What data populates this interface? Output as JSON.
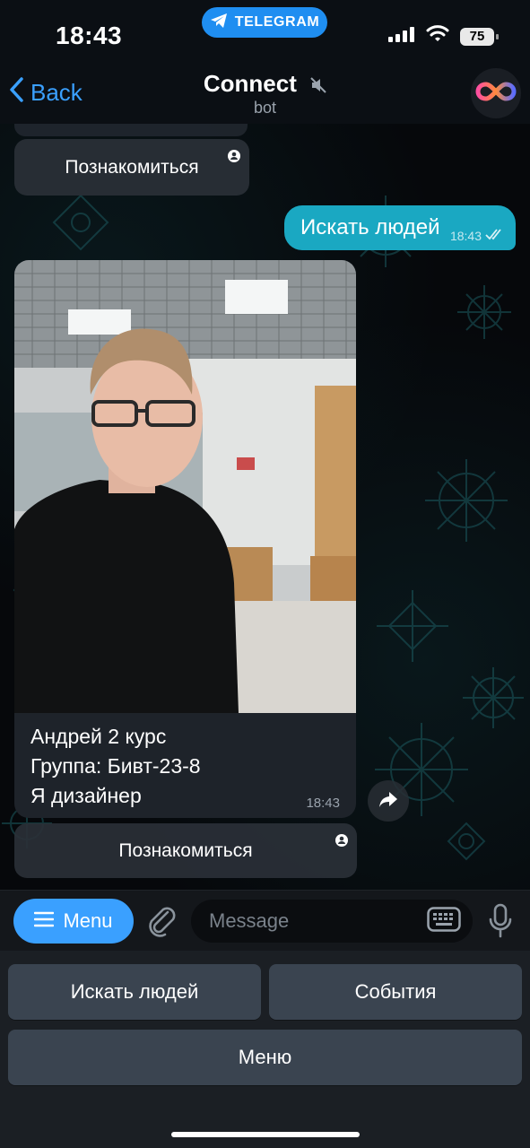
{
  "status_bar": {
    "time": "18:43",
    "app_pill": "TELEGRAM",
    "battery": "75"
  },
  "header": {
    "back_label": "Back",
    "title": "Connect",
    "subtitle": "bot"
  },
  "messages": {
    "top_inline_button": "Познакомиться",
    "outgoing": {
      "text": "Искать людей",
      "time": "18:43"
    },
    "profile": {
      "lines": [
        "Андрей 2 курс",
        "Группа: Бивт-23-8",
        "Я дизайнер"
      ],
      "time": "18:43",
      "inline_button": "Познакомиться"
    }
  },
  "composer": {
    "menu_label": "Menu",
    "placeholder": "Message"
  },
  "reply_keyboard": {
    "buttons": [
      "Искать людей",
      "События",
      "Меню"
    ]
  },
  "colors": {
    "accent": "#3aa0ff",
    "outgoing_bubble": "#1aa8c2",
    "telegram_pill": "#1f8ef1"
  }
}
